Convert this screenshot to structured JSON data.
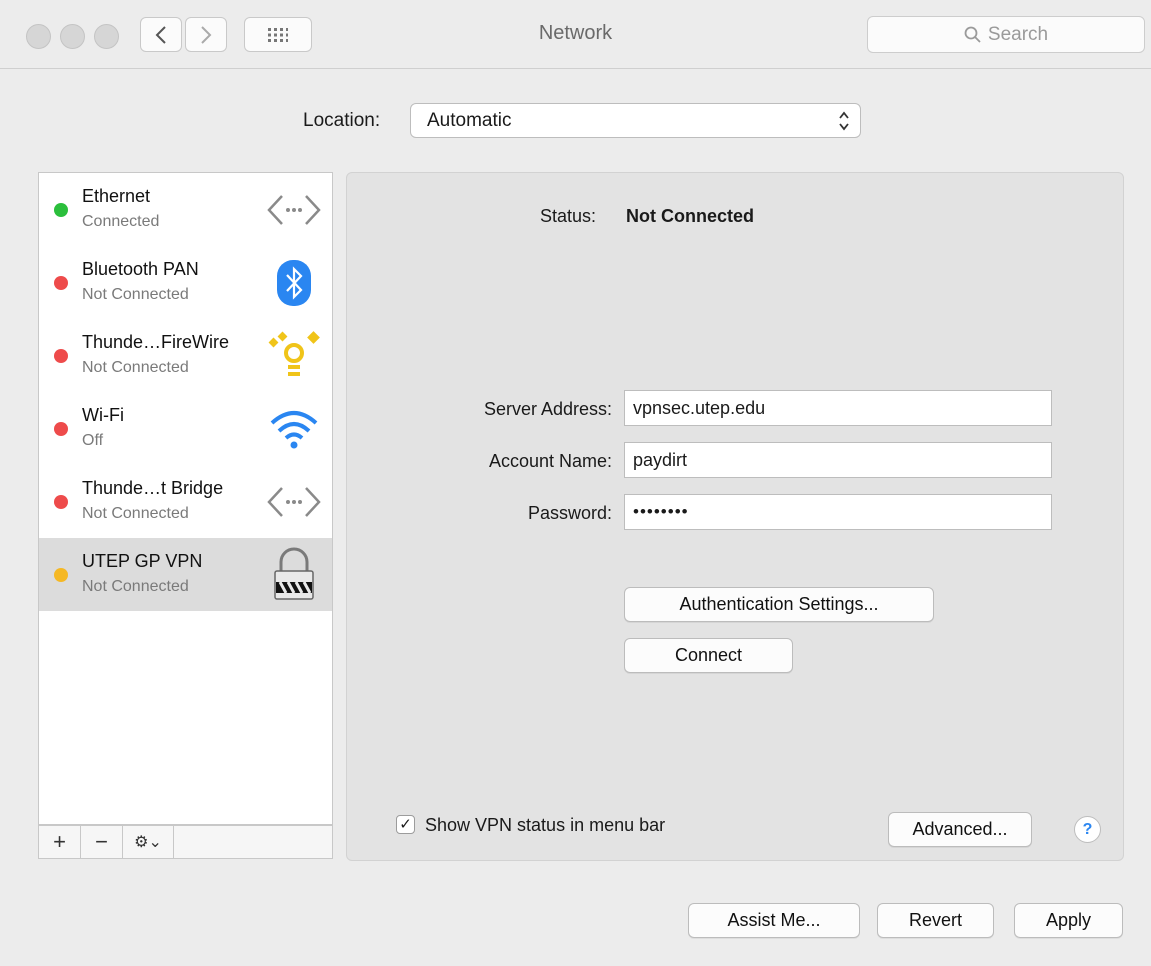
{
  "window": {
    "title": "Network",
    "search_placeholder": "Search"
  },
  "location": {
    "label": "Location:",
    "value": "Automatic"
  },
  "services": [
    {
      "name": "Ethernet",
      "status": "Connected",
      "dot_color": "#2bbf3c",
      "icon": "ethernet-icon"
    },
    {
      "name": "Bluetooth PAN",
      "status": "Not Connected",
      "dot_color": "#ee4b4b",
      "icon": "bluetooth-icon"
    },
    {
      "name": "Thunde…FireWire",
      "status": "Not Connected",
      "dot_color": "#ee4b4b",
      "icon": "firewire-icon"
    },
    {
      "name": "Wi-Fi",
      "status": "Off",
      "dot_color": "#ee4b4b",
      "icon": "wifi-icon"
    },
    {
      "name": "Thunde…t Bridge",
      "status": "Not Connected",
      "dot_color": "#ee4b4b",
      "icon": "ethernet-icon"
    },
    {
      "name": "UTEP GP VPN",
      "status": "Not Connected",
      "dot_color": "#f5b824",
      "icon": "vpn-lock-icon",
      "selected": true
    }
  ],
  "sidebar_toolbar": {
    "add": "+",
    "remove": "−",
    "action": "⚙⌄"
  },
  "detail": {
    "status_label": "Status:",
    "status_value": "Not Connected",
    "server_address_label": "Server Address:",
    "server_address_value": "vpnsec.utep.edu",
    "account_name_label": "Account Name:",
    "account_name_value": "paydirt",
    "password_label": "Password:",
    "password_value": "••••••••",
    "auth_button": "Authentication Settings...",
    "connect_button": "Connect",
    "show_vpn_label": "Show VPN status in menu bar",
    "show_vpn_checked": true,
    "advanced_button": "Advanced...",
    "help_button": "?"
  },
  "footer": {
    "assist_button": "Assist Me...",
    "revert_button": "Revert",
    "apply_button": "Apply"
  },
  "colors": {
    "accent": "#2a86f1",
    "connected": "#2bbf3c",
    "not_connected": "#ee4b4b",
    "inactive": "#f5b824"
  }
}
